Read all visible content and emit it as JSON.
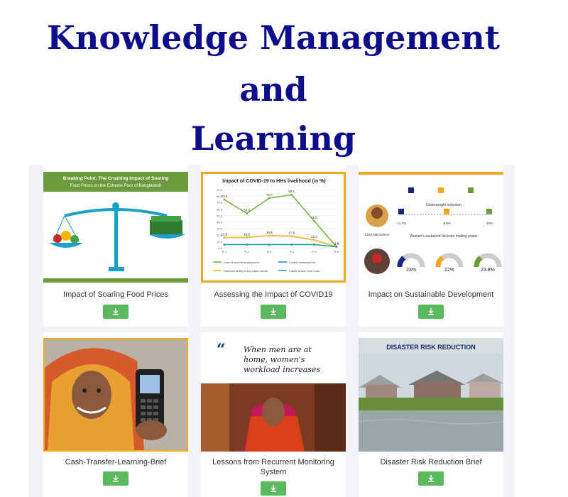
{
  "header": {
    "line1": "Knowledge Management",
    "line2": "and",
    "line3": "Learning"
  },
  "colors": {
    "title": "#0d0d8c",
    "download_button": "#5cb85c",
    "frame_green": "#6e9a3e",
    "frame_orange": "#f2a81e"
  },
  "cards": [
    {
      "caption": "Impact of Soaring Food Prices",
      "thumb_title": "Breaking Point: The Crushing Impact of Soaring Food Prices on the Extreme Poor of Bangladesh",
      "download_icon": "download-icon"
    },
    {
      "caption": "Assessing the Impact of COVID19",
      "thumb_title": "Impact of COVID-19 to HHs livelihood (in %)",
      "download_icon": "download-icon"
    },
    {
      "caption": "Impact on Sustainable Development",
      "thumb_subtitle": "Underweight reduction",
      "thumb_caption": "Women's sustained decision making power",
      "thumb_label": "Child Malnutrition",
      "download_icon": "download-icon"
    },
    {
      "caption": "Cash-Transfer-Learning-Brief",
      "download_icon": "download-icon"
    },
    {
      "caption": "Lessons from Recurrent Monitoring System",
      "quote": "When men are at home, women's workload increases",
      "download_icon": "download-icon"
    },
    {
      "caption": "Disaster Risk Reduction Brief",
      "thumb_title": "DISASTER RISK REDUCTION",
      "download_icon": "download-icon"
    }
  ],
  "chart_data": {
    "type": "line",
    "title": "Impact of COVID-19 to HHs livelihood (in %)",
    "categories": [
      "R-1",
      "R-2",
      "R-3",
      "R-4",
      "R-5",
      "R-6"
    ],
    "ylim": [
      0,
      90
    ],
    "y_ticks": [
      "0.0",
      "10.0",
      "20.0",
      "30.0",
      "40.0",
      "50.0",
      "60.0",
      "70.0",
      "80.0",
      "90.0"
    ],
    "series": [
      {
        "name": "Loss of income/employment",
        "values": [
          74.6,
          53.0,
          76.7,
          82.1,
          41.6,
          1.6
        ],
        "color": "#7cb342"
      },
      {
        "name": "Closed business/IGA",
        "values": [
          15.8,
          16.0,
          18.8,
          17.9,
          12.2,
          1.6
        ],
        "color": "#1e88e5"
      },
      {
        "name": "Reduced ability to buy basic needs",
        "values": [
          15.8,
          16.0,
          18.8,
          17.9,
          12.2,
          1.6
        ],
        "color": "#fbc02d"
      },
      {
        "name": "Faced severe food crisis",
        "values": [
          5,
          5,
          5,
          5,
          5,
          1.6
        ],
        "color": "#26a69a"
      }
    ],
    "labels": [
      "74.6",
      "53.0",
      "76.7",
      "82.1",
      "41.6",
      "15.8",
      "16.0",
      "18.8",
      "17.9",
      "12.2",
      "1.6"
    ]
  },
  "sdg_chart": {
    "values": [
      "-11.7%",
      "-6.9%",
      "-10%"
    ],
    "donuts": [
      "23%",
      "22%",
      "23.8%"
    ]
  }
}
